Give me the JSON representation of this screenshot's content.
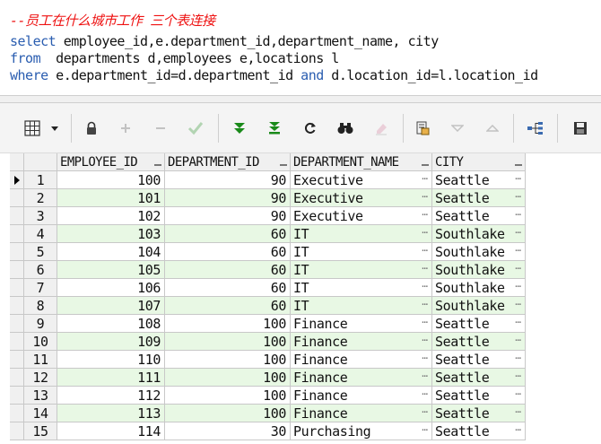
{
  "sql": {
    "comment": "--员工在什么城市工作 三个表连接",
    "line2_kw": "select",
    "line2_rest": " employee_id,e.department_id,department_name, city",
    "line3_kw": "from",
    "line3_rest": "  departments d,employees e,locations l",
    "line4_kw1": "where",
    "line4_mid": " e.department_id=d.department_id ",
    "line4_kw2": "and",
    "line4_rest": " d.location_id=l.location_id"
  },
  "toolbar": {
    "icons": [
      "grid-layout-icon",
      "dropdown-arrow-icon",
      "lock-icon",
      "add-record-icon",
      "delete-record-icon",
      "post-changes-icon",
      "fetch-next-icon",
      "fetch-last-icon",
      "refresh-icon",
      "find-icon",
      "clear-icon",
      "export-icon",
      "filter-down-icon",
      "filter-up-icon",
      "query-plan-icon",
      "save-icon"
    ],
    "colors": {
      "fetch": "#1a8a1a",
      "check": "#5cb85c"
    }
  },
  "grid": {
    "columns": [
      "EMPLOYEE_ID",
      "DEPARTMENT_ID",
      "DEPARTMENT_NAME",
      "CITY"
    ],
    "rows": [
      {
        "n": "1",
        "emp": "100",
        "dept": "90",
        "dname": "Executive",
        "city": "Seattle"
      },
      {
        "n": "2",
        "emp": "101",
        "dept": "90",
        "dname": "Executive",
        "city": "Seattle"
      },
      {
        "n": "3",
        "emp": "102",
        "dept": "90",
        "dname": "Executive",
        "city": "Seattle"
      },
      {
        "n": "4",
        "emp": "103",
        "dept": "60",
        "dname": "IT",
        "city": "Southlake"
      },
      {
        "n": "5",
        "emp": "104",
        "dept": "60",
        "dname": "IT",
        "city": "Southlake"
      },
      {
        "n": "6",
        "emp": "105",
        "dept": "60",
        "dname": "IT",
        "city": "Southlake"
      },
      {
        "n": "7",
        "emp": "106",
        "dept": "60",
        "dname": "IT",
        "city": "Southlake"
      },
      {
        "n": "8",
        "emp": "107",
        "dept": "60",
        "dname": "IT",
        "city": "Southlake"
      },
      {
        "n": "9",
        "emp": "108",
        "dept": "100",
        "dname": "Finance",
        "city": "Seattle"
      },
      {
        "n": "10",
        "emp": "109",
        "dept": "100",
        "dname": "Finance",
        "city": "Seattle"
      },
      {
        "n": "11",
        "emp": "110",
        "dept": "100",
        "dname": "Finance",
        "city": "Seattle"
      },
      {
        "n": "12",
        "emp": "111",
        "dept": "100",
        "dname": "Finance",
        "city": "Seattle"
      },
      {
        "n": "13",
        "emp": "112",
        "dept": "100",
        "dname": "Finance",
        "city": "Seattle"
      },
      {
        "n": "14",
        "emp": "113",
        "dept": "100",
        "dname": "Finance",
        "city": "Seattle"
      },
      {
        "n": "15",
        "emp": "114",
        "dept": "30",
        "dname": "Purchasing",
        "city": "Seattle"
      }
    ],
    "colors": {
      "alt_row": "#e8f8e4",
      "header": "#f0f0f0"
    }
  }
}
